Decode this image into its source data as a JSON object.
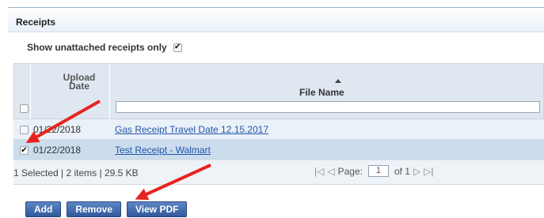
{
  "section": {
    "title": "Receipts"
  },
  "filter": {
    "label": "Show unattached receipts only",
    "checked": "✔"
  },
  "grid": {
    "columns": {
      "upload_date": "Upload Date",
      "file_name": "File Name"
    },
    "rows": [
      {
        "date": "01/22/2018",
        "file": "Gas Receipt Travel Date 12.15.2017",
        "checked": ""
      },
      {
        "date": "01/22/2018",
        "file": "Test Receipt - Walmart",
        "checked": "✔"
      }
    ],
    "footer": {
      "summary": "1 Selected | 2 items | 29.5 KB",
      "page_label": "Page:",
      "page_value": "1",
      "of_label": "of 1",
      "first_icon": "|◁",
      "prev_icon": "◁",
      "next_icon": "▷",
      "last_icon": "▷|"
    }
  },
  "buttons": {
    "add": "Add",
    "remove": "Remove",
    "view_pdf": "View PDF"
  },
  "colors": {
    "annotation_arrow": "#e8231f",
    "button": "#3f67ab",
    "link": "#2255aa"
  }
}
